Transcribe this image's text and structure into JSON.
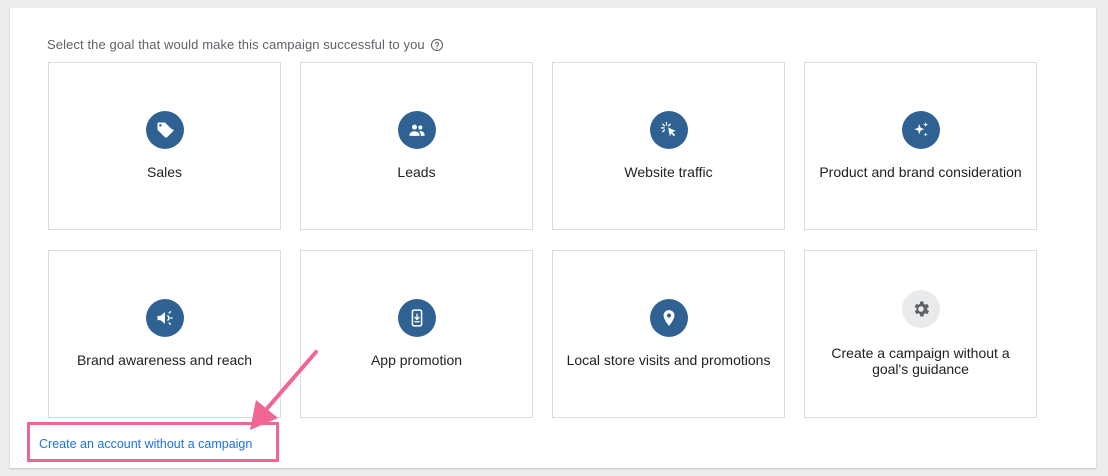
{
  "prompt": {
    "text": "Select the goal that would make this campaign successful to you",
    "help_icon": "question-circle-icon"
  },
  "goals": [
    {
      "label": "Sales",
      "icon": "tag-icon"
    },
    {
      "label": "Leads",
      "icon": "people-icon"
    },
    {
      "label": "Website traffic",
      "icon": "cursor-click-icon"
    },
    {
      "label": "Product and brand consideration",
      "icon": "sparkle-icon"
    },
    {
      "label": "Brand awareness and reach",
      "icon": "megaphone-icon"
    },
    {
      "label": "App promotion",
      "icon": "phone-download-icon"
    },
    {
      "label": "Local store visits and promotions",
      "icon": "map-pin-icon"
    },
    {
      "label": "Create a campaign without a goal's guidance",
      "icon": "gear-icon"
    }
  ],
  "footer_link": {
    "text": "Create an account without a campaign"
  },
  "colors": {
    "icon_bg": "#2f6293",
    "icon_bg_muted": "#e9eaec",
    "highlight": "#f06595",
    "link": "#1a73e8"
  }
}
